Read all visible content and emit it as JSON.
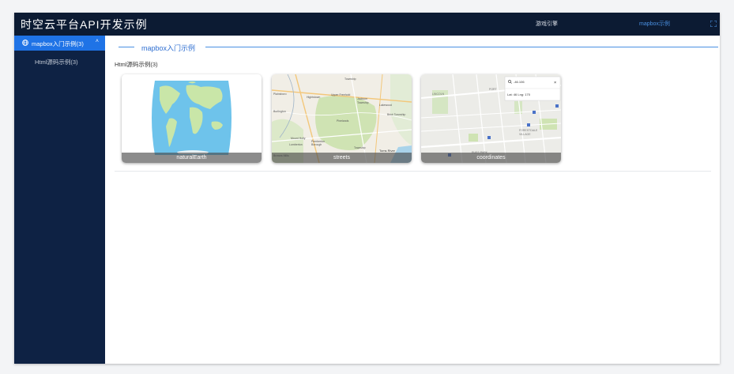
{
  "app": {
    "title": "时空云平台API开发示例"
  },
  "nav": {
    "items": [
      {
        "label": "游戏引擎",
        "active": false
      },
      {
        "label": "mapbox示例",
        "active": true
      }
    ]
  },
  "sidebar": {
    "group_label": "mapbox入门示例(3)",
    "sub_label": "Html源码示例(3)"
  },
  "main": {
    "section_title": "mapbox入门示例",
    "subsection_title": "Html源码示例(3)",
    "cards": [
      {
        "caption": "naturalEarth"
      },
      {
        "caption": "streets"
      },
      {
        "caption": "coordinates"
      }
    ]
  },
  "map_text": {
    "streets_places": [
      "Township",
      "Upper Freehold",
      "Jackson",
      "Township",
      "Lakewood",
      "Brick Township",
      "Hightstown",
      "Plainsboro",
      "Toms River",
      "Burlington",
      "Mount Holly",
      "Lumberton",
      "Pemberton",
      "Borough",
      "Township",
      "Pinelands",
      "Browns Mills"
    ],
    "coordinates_search": "-46.106",
    "coordinates_readout": "Lat: 46 Lng: 170",
    "coordinates_places": [
      "LINCOLN",
      "FORESTDALE",
      "VILLAGE",
      "PORT",
      "RUES PARK"
    ]
  },
  "colors": {
    "topbar": "#0c1b33",
    "sidebar": "#0e2244",
    "accent": "#1f73e6",
    "section": "#2f6fd1",
    "ocean": "#6ec3eb",
    "land": "#c9e6a8"
  },
  "icons": {
    "fullscreen": "fullscreen-icon",
    "group": "globe-icon",
    "chevron": "chevron-up-icon",
    "search": "search-icon",
    "close": "close-icon"
  }
}
